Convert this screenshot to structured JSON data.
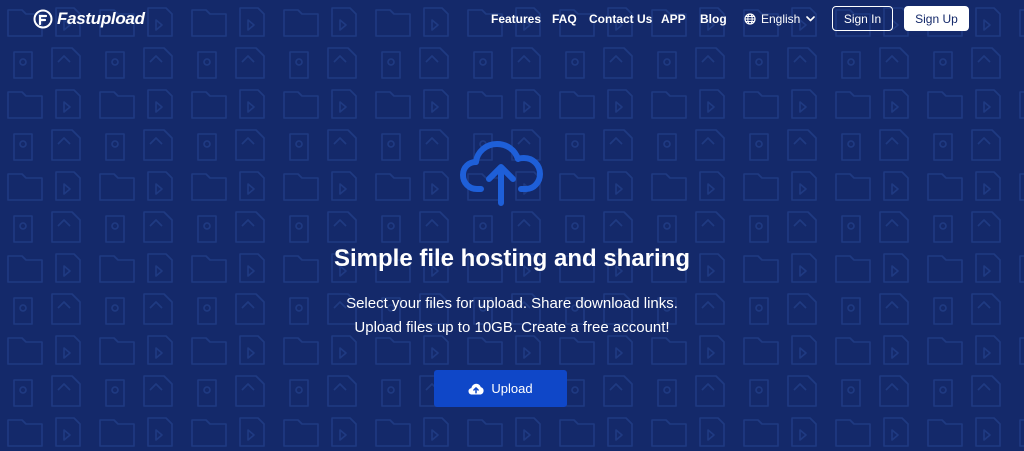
{
  "brand": {
    "name": "Fastupload"
  },
  "nav": {
    "items": [
      {
        "label": "Features"
      },
      {
        "label": "FAQ"
      },
      {
        "label": "Contact Us"
      },
      {
        "label": "APP"
      },
      {
        "label": "Blog"
      }
    ],
    "language": {
      "selected": "English",
      "icon": "globe-icon"
    },
    "sign_in_label": "Sign In",
    "sign_up_label": "Sign Up"
  },
  "hero": {
    "icon": "cloud-upload-icon",
    "title": "Simple file hosting and sharing",
    "description_line1": "Select your files for upload. Share download links.",
    "description_line2": "Upload files up to 10GB. Create a free account!",
    "upload_label": "Upload",
    "upload_icon": "cloud-upload-small-icon"
  },
  "colors": {
    "background": "#14296a",
    "accent": "#0f47c8",
    "icon_blue": "#1e5fd8",
    "pattern": "#1c3478"
  }
}
